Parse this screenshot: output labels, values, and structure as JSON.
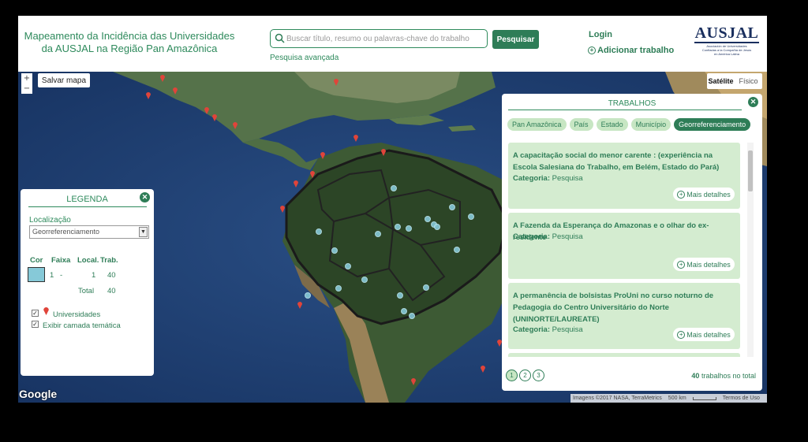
{
  "header": {
    "title_line1": "Mapeamento da Incidência das Universidades",
    "title_line2": "da AUSJAL na Região Pan Amazônica",
    "search_placeholder": "Buscar título, resumo ou palavras-chave do trabalho",
    "search_button": "Pesquisar",
    "advanced_search": "Pesquisa avançada",
    "login": "Login",
    "add_work": "Adicionar trabalho",
    "logo_text": "AUSJAL",
    "logo_subtitle_1": "Asociación de Universidades",
    "logo_subtitle_2": "Confiadas a la Compañía de Jesús",
    "logo_subtitle_3": "en América Latina"
  },
  "map_controls": {
    "zoom_in": "+",
    "zoom_out": "−",
    "save_map": "Salvar mapa",
    "map_types": [
      "Satélite",
      "Físico"
    ],
    "active_map_type": "Satélite",
    "google": "Google",
    "attribution": "Imagens ©2017 NASA, TerraMetrics",
    "scale": "500 km",
    "terms": "Termos de Uso"
  },
  "legend": {
    "title": "LEGENDA",
    "location_label": "Localização",
    "location_value": "Georreferenciamento",
    "columns": [
      "Cor",
      "Faixa",
      "Local.",
      "Trab."
    ],
    "row": {
      "color": "#86c9d8",
      "range_from": "1",
      "range_sep": "-",
      "local": "1",
      "trab": "40"
    },
    "total_label": "Total",
    "total_value": "40",
    "checkbox_universities": "Universidades",
    "checkbox_thematic": "Exibir camada temática"
  },
  "panel": {
    "title": "TRABALHOS",
    "tabs": [
      "Pan Amazônica",
      "País",
      "Estado",
      "Município",
      "Georreferenciamento"
    ],
    "active_tab": "Georreferenciamento",
    "cards": [
      {
        "title": "A capacitação social do menor carente : (experiência na Escola Salesiana do Trabalho, em Belém, Estado do Pará)",
        "category_label": "Categoria:",
        "category": "Pesquisa",
        "more": "Mais detalhes"
      },
      {
        "title": "A Fazenda da Esperança do Amazonas e o olhar do ex-residente",
        "category_label": "Categoria:",
        "category": "Pesquisa",
        "more": "Mais detalhes"
      },
      {
        "title": "A permanência de bolsistas ProUni no curso noturno de Pedagogia do Centro Universitário do Norte (UNINORTE/LAUREATE)",
        "category_label": "Categoria:",
        "category": "Pesquisa",
        "more": "Mais detalhes"
      }
    ],
    "pages": [
      "1",
      "2",
      "3"
    ],
    "active_page": "1",
    "total_count": "40",
    "total_suffix": "trabalhos no total"
  },
  "colors": {
    "brand_green": "#2e7d57",
    "light_green": "#d4ecd0",
    "pin_red": "#e0443a",
    "dot_blue": "#86c9d8"
  }
}
